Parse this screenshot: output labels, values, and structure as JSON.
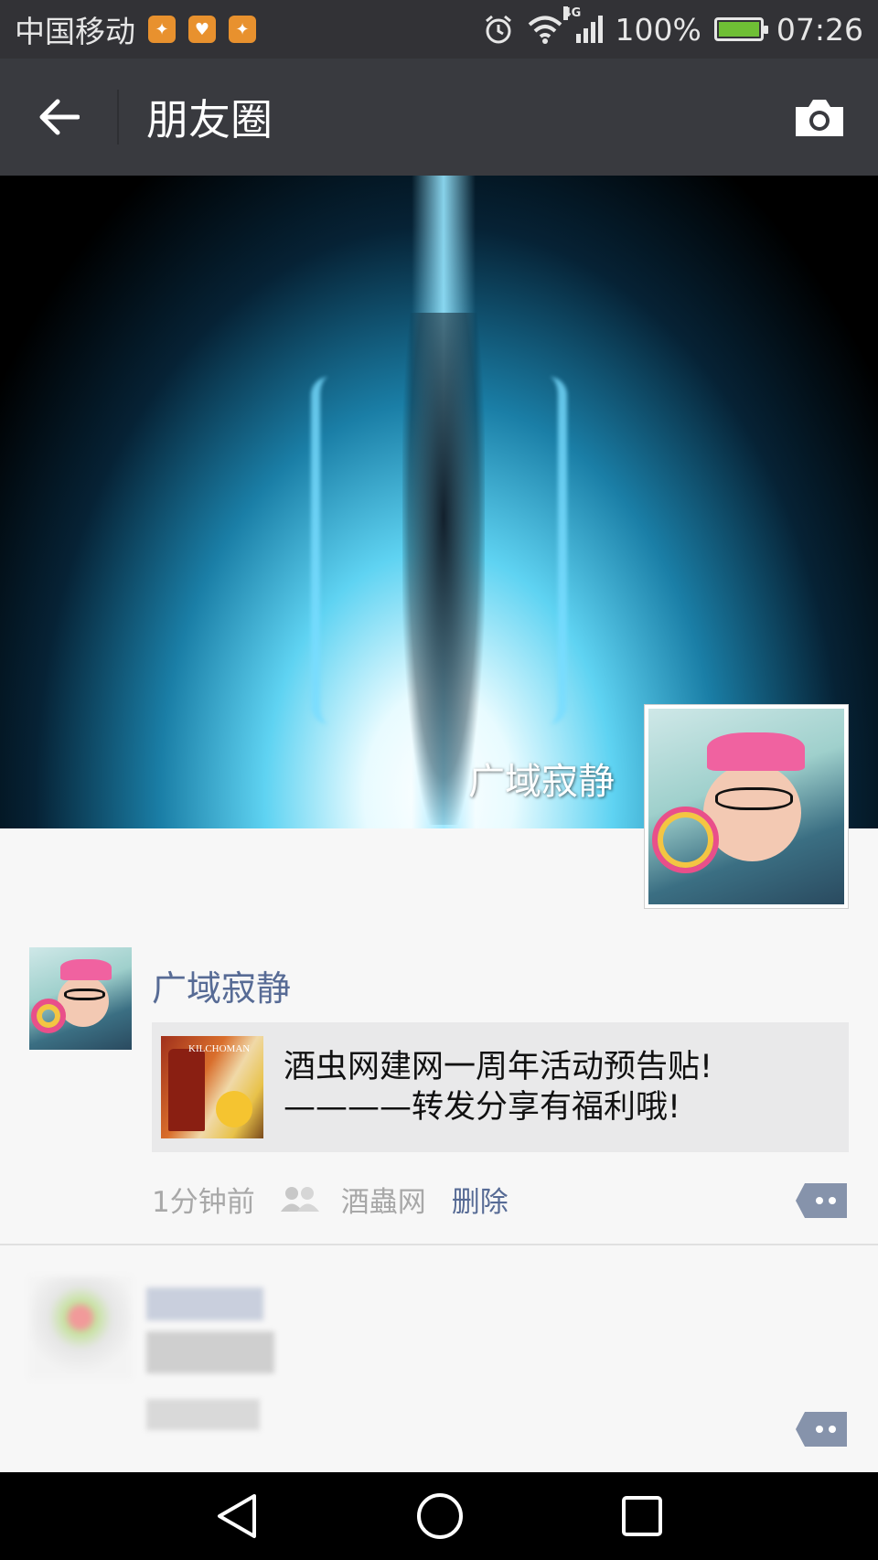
{
  "status_bar": {
    "carrier": "中国移动",
    "network": "4G",
    "battery_percent": "100%",
    "time": "07:26",
    "notification_icons": [
      "uc-browser-icon",
      "health-icon",
      "uc-browser-icon"
    ]
  },
  "nav": {
    "title": "朋友圈",
    "back_icon": "back-arrow-icon",
    "camera_icon": "camera-icon"
  },
  "cover": {
    "user_name": "广域寂静"
  },
  "post": {
    "author": "广域寂静",
    "share_title_line1": "酒虫网建网一周年活动预告贴!",
    "share_title_line2": "————转发分享有福利哦!",
    "time": "1分钟前",
    "source": "酒蟲网",
    "delete_label": "删除"
  },
  "colors": {
    "nav_bg": "#393a3f",
    "status_bg": "#323236",
    "link_blue": "#576b95",
    "card_bg": "#e9e9ea",
    "page_bg": "#f7f7f7"
  }
}
